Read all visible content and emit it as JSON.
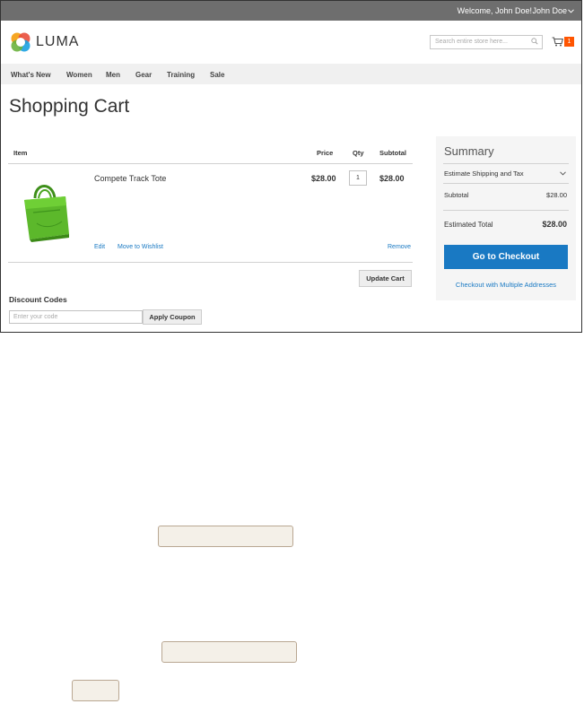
{
  "header": {
    "welcome": "Welcome, John Doe!",
    "user_menu": "John Doe",
    "user_menu_icon": "chevron-down-icon",
    "logo_text": "LUMA",
    "search_placeholder": "Search entire store here...",
    "cart_count": "1",
    "accent_color": "#ff5501"
  },
  "nav": {
    "items": [
      "What's New",
      "Women",
      "Men",
      "Gear",
      "Training",
      "Sale"
    ]
  },
  "page": {
    "title": "Shopping Cart"
  },
  "cart": {
    "columns": [
      "Item",
      "Price",
      "Qty",
      "Subtotal"
    ],
    "items": [
      {
        "name": "Compete Track Tote",
        "price": "$28.00",
        "qty": "1",
        "subtotal": "$28.00",
        "edit_label": "Edit",
        "wishlist_label": "Move to Wishlist",
        "remove_label": "Remove"
      }
    ],
    "update_label": "Update Cart"
  },
  "discount": {
    "title": "Discount Codes",
    "placeholder": "Enter your code",
    "apply_label": "Apply Coupon"
  },
  "summary": {
    "title": "Summary",
    "shipping_label": "Estimate Shipping and Tax",
    "subtotal_label": "Subtotal",
    "subtotal_value": "$28.00",
    "total_label": "Estimated Total",
    "total_value": "$28.00",
    "checkout_label": "Go to Checkout",
    "multi_label": "Checkout with Multiple Addresses",
    "button_color": "#1979c3"
  }
}
